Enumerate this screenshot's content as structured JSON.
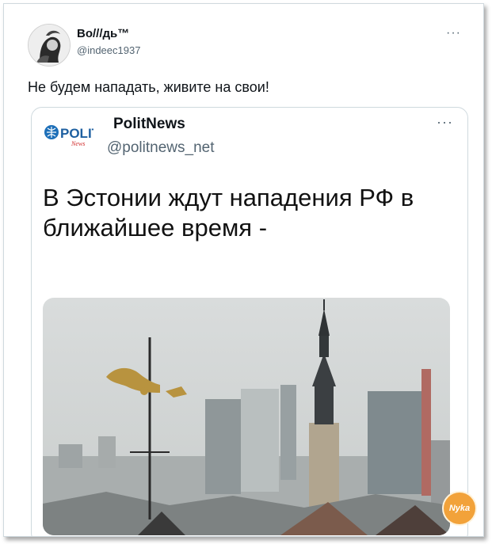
{
  "tweet": {
    "author_name": "Во///дь™",
    "author_handle": "@indeec1937",
    "more_icon": "more-horizontal-icon",
    "text": "Не будем нападать, живите на свои!"
  },
  "quoted_tweet": {
    "author_name": "PolitNews",
    "author_handle": "@politnews_net",
    "logo_text": "POLIT",
    "logo_subtext": "News",
    "more_icon": "more-horizontal-icon",
    "headline": "В Эстонии ждут нападения РФ в ближайшее время -",
    "photo": "city-skyline-photo"
  },
  "watermark_text": "Nyka"
}
